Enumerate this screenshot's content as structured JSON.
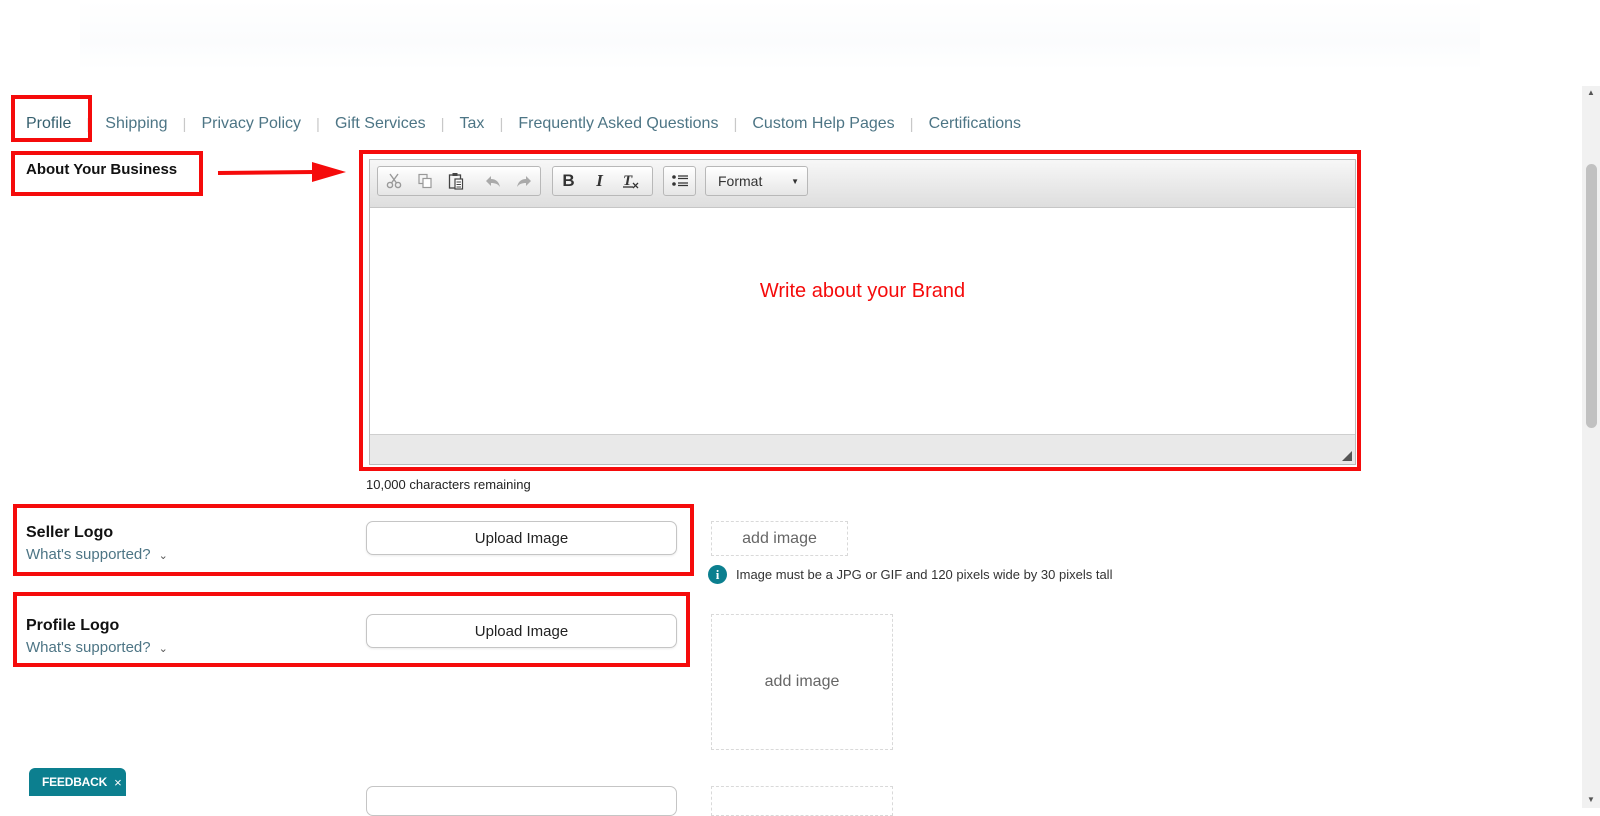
{
  "tabs": [
    {
      "label": "Profile"
    },
    {
      "label": "Shipping"
    },
    {
      "label": "Privacy Policy"
    },
    {
      "label": "Gift Services"
    },
    {
      "label": "Tax"
    },
    {
      "label": "Frequently Asked Questions"
    },
    {
      "label": "Custom Help Pages"
    },
    {
      "label": "Certifications"
    }
  ],
  "about": {
    "label": "About Your Business",
    "placeholder": "Write about your Brand",
    "chars_remaining": "10,000 characters remaining"
  },
  "editor_toolbar": {
    "bold": "B",
    "italic": "I",
    "format_label": "Format",
    "icons": [
      "cut-icon",
      "copy-icon",
      "paste-icon",
      "undo-icon",
      "redo-icon",
      "bold-icon",
      "italic-icon",
      "remove-format-icon",
      "bulleted-list-icon",
      "caret-down-icon"
    ]
  },
  "seller_logo": {
    "label": "Seller Logo",
    "supported": "What's supported?",
    "upload": "Upload Image",
    "add_image": "add image",
    "info": "Image must be a JPG or GIF and 120 pixels wide by 30 pixels tall"
  },
  "profile_logo": {
    "label": "Profile Logo",
    "supported": "What's supported?",
    "upload": "Upload Image",
    "add_image": "add image"
  },
  "feedback": {
    "label": "FEEDBACK",
    "close": "×"
  },
  "colors": {
    "annotation_red": "#f50b0b",
    "link": "#4d7585",
    "feedback_bg": "#0c7f8f"
  }
}
